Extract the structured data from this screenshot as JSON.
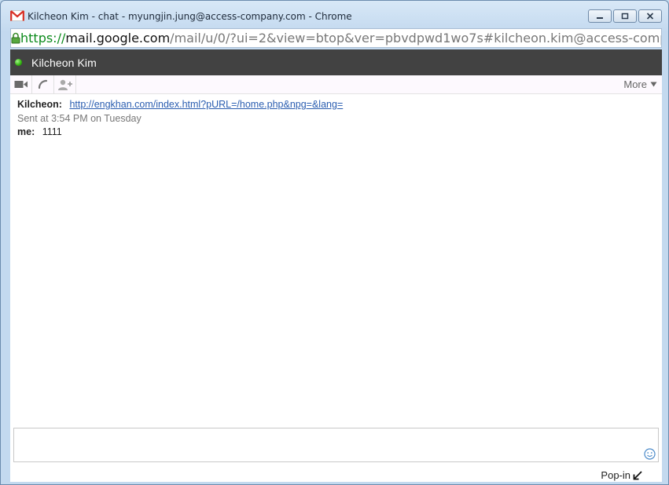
{
  "window": {
    "title": "Kilcheon Kim - chat - myungjin.jung@access-company.com - Chrome",
    "app_icon": "gmail-icon",
    "controls": [
      "minimize-icon",
      "restore-icon",
      "close-icon"
    ]
  },
  "url": {
    "scheme": "https://",
    "host": "mail.google.com",
    "path": "/mail/u/0/?ui=2&view=btop&ver=pbvdpwd1wo7s#kilcheon.kim@access-company.com"
  },
  "chat": {
    "contact_name": "Kilcheon Kim",
    "status_color": "#2fb00c",
    "header_bg": "#424242"
  },
  "toolbar": {
    "icons": [
      "video-call-icon",
      "phone-call-icon",
      "add-person-icon"
    ],
    "more_label": "More",
    "more_icon": "caret-down-icon"
  },
  "messages": [
    {
      "sender": "Kilcheon:",
      "link": "http://engkhan.com/index.html?pURL=/home.php&npg=&lang="
    },
    {
      "timestamp": "Sent at 3:54 PM on Tuesday"
    },
    {
      "sender": "me:",
      "text": "1111"
    }
  ],
  "composer": {
    "value": "",
    "emoji_icon": "smiley-icon",
    "popin_label": "Pop-in",
    "popin_icon": "arrow-down-left-icon"
  }
}
